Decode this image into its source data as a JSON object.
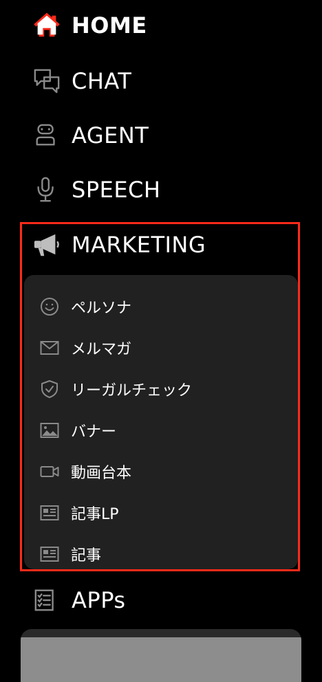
{
  "nav": {
    "home": {
      "label": "HOME",
      "icon": "home-icon"
    },
    "chat": {
      "label": "CHAT",
      "icon": "chat-bubbles-icon"
    },
    "agent": {
      "label": "AGENT",
      "icon": "robot-icon"
    },
    "speech": {
      "label": "SPEECH",
      "icon": "microphone-icon"
    },
    "marketing": {
      "label": "MARKETING",
      "icon": "megaphone-icon"
    },
    "apps": {
      "label": "APPs",
      "icon": "checklist-icon"
    }
  },
  "marketing_submenu": [
    {
      "label": "ペルソナ",
      "icon": "smile-icon"
    },
    {
      "label": "メルマガ",
      "icon": "envelope-icon"
    },
    {
      "label": "リーガルチェック",
      "icon": "shield-check-icon"
    },
    {
      "label": "バナー",
      "icon": "image-icon"
    },
    {
      "label": "動画台本",
      "icon": "video-camera-icon"
    },
    {
      "label": "記事LP",
      "icon": "newspaper-icon"
    },
    {
      "label": "記事",
      "icon": "newspaper-icon"
    }
  ],
  "colors": {
    "background": "#000000",
    "submenu_bg": "#212121",
    "highlight_border": "#ff2a1a",
    "home_icon_accent": "#ff2a1a",
    "icon_gray": "#8a8a8a"
  }
}
